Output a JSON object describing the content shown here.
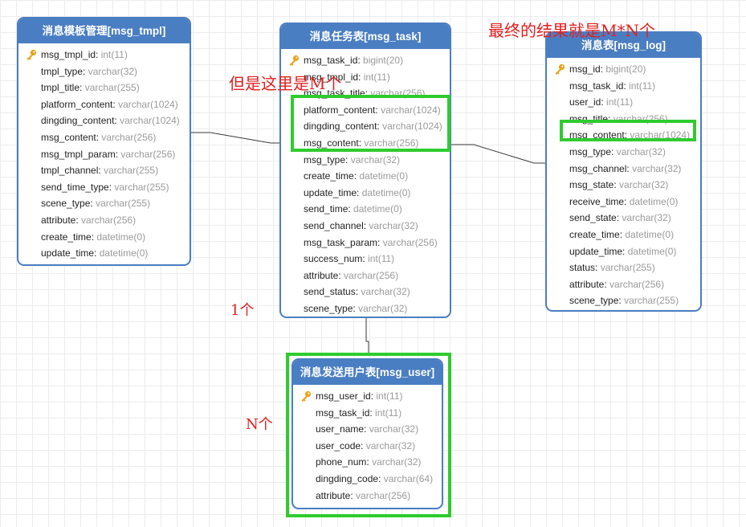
{
  "tables": {
    "tmpl": {
      "title": "消息模板管理[msg_tmpl]",
      "fields": [
        {
          "name": "msg_tmpl_id",
          "type": "int(11)",
          "pk": true
        },
        {
          "name": "tmpl_type",
          "type": "varchar(32)"
        },
        {
          "name": "tmpl_title",
          "type": "varchar(255)"
        },
        {
          "name": "platform_content",
          "type": "varchar(1024)"
        },
        {
          "name": "dingding_content",
          "type": "varchar(1024)"
        },
        {
          "name": "msg_content",
          "type": "varchar(256)"
        },
        {
          "name": "msg_tmpl_param",
          "type": "varchar(256)"
        },
        {
          "name": "tmpl_channel",
          "type": "varchar(255)"
        },
        {
          "name": "send_time_type",
          "type": "varchar(255)"
        },
        {
          "name": "scene_type",
          "type": "varchar(255)"
        },
        {
          "name": "attribute",
          "type": "varchar(256)"
        },
        {
          "name": "create_time",
          "type": "datetime(0)"
        },
        {
          "name": "update_time",
          "type": "datetime(0)"
        }
      ]
    },
    "task": {
      "title": "消息任务表[msg_task]",
      "fields": [
        {
          "name": "msg_task_id",
          "type": "bigint(20)",
          "pk": true
        },
        {
          "name": "msg_tmpl_id",
          "type": "int(11)"
        },
        {
          "name": "msg_task_title",
          "type": "varchar(256)"
        },
        {
          "name": "platform_content",
          "type": "varchar(1024)"
        },
        {
          "name": "dingding_content",
          "type": "varchar(1024)"
        },
        {
          "name": "msg_content",
          "type": "varchar(256)"
        },
        {
          "name": "msg_type",
          "type": "varchar(32)"
        },
        {
          "name": "create_time",
          "type": "datetime(0)"
        },
        {
          "name": "update_time",
          "type": "datetime(0)"
        },
        {
          "name": "send_time",
          "type": "datetime(0)"
        },
        {
          "name": "send_channel",
          "type": "varchar(32)"
        },
        {
          "name": "msg_task_param",
          "type": "varchar(256)"
        },
        {
          "name": "success_num",
          "type": "int(11)"
        },
        {
          "name": "attribute",
          "type": "varchar(256)"
        },
        {
          "name": "send_status",
          "type": "varchar(32)"
        },
        {
          "name": "scene_type",
          "type": "varchar(32)"
        }
      ]
    },
    "log": {
      "title": "消息表[msg_log]",
      "fields": [
        {
          "name": "msg_id",
          "type": "bigint(20)",
          "pk": true
        },
        {
          "name": "msg_task_id",
          "type": "int(11)"
        },
        {
          "name": "user_id",
          "type": "int(11)"
        },
        {
          "name": "msg_title",
          "type": "varchar(256)"
        },
        {
          "name": "msg_content",
          "type": "varchar(1024)"
        },
        {
          "name": "msg_type",
          "type": "varchar(32)"
        },
        {
          "name": "msg_channel",
          "type": "varchar(32)"
        },
        {
          "name": "msg_state",
          "type": "varchar(32)"
        },
        {
          "name": "receive_time",
          "type": "datetime(0)"
        },
        {
          "name": "send_state",
          "type": "varchar(32)"
        },
        {
          "name": "create_time",
          "type": "datetime(0)"
        },
        {
          "name": "update_time",
          "type": "datetime(0)"
        },
        {
          "name": "status",
          "type": "varchar(255)"
        },
        {
          "name": "attribute",
          "type": "varchar(256)"
        },
        {
          "name": "scene_type",
          "type": "varchar(255)"
        }
      ]
    },
    "user": {
      "title": "消息发送用户表[msg_user]",
      "fields": [
        {
          "name": "msg_user_id",
          "type": "int(11)",
          "pk": true
        },
        {
          "name": "msg_task_id",
          "type": "int(11)"
        },
        {
          "name": "user_name",
          "type": "varchar(32)"
        },
        {
          "name": "user_code",
          "type": "varchar(32)"
        },
        {
          "name": "phone_num",
          "type": "varchar(32)"
        },
        {
          "name": "dingding_code",
          "type": "varchar(64)"
        },
        {
          "name": "attribute",
          "type": "varchar(256)"
        }
      ]
    }
  },
  "annotations": {
    "result": "最终的结果就是M*N个",
    "m_count": "但是这里是M个",
    "one": "1个",
    "n_count": "N个"
  },
  "colors": {
    "entity_header": "#4a7ec3",
    "highlight": "#2ecc2e",
    "annotation": "#e0201f",
    "field_type": "#9a9a9a"
  },
  "icons": {
    "primary_key": "key-icon"
  }
}
